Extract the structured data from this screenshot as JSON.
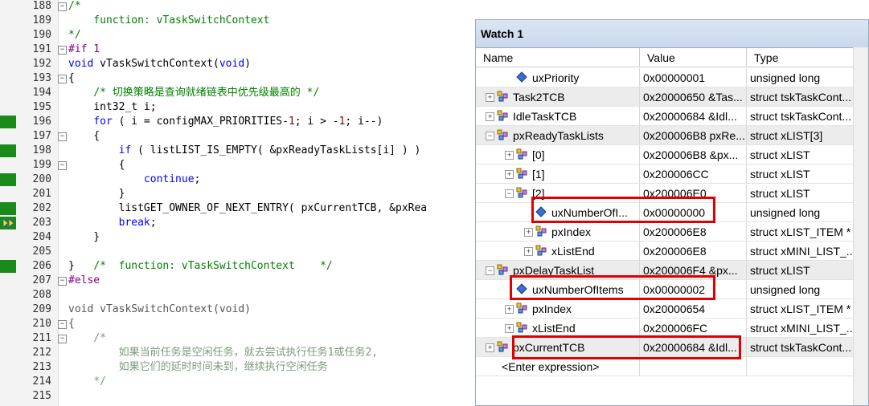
{
  "editor": {
    "lines": [
      {
        "n": "188",
        "fold": "−",
        "html": "<span class='cm'>/*</span>"
      },
      {
        "n": "189",
        "html": "<span class='cm'>    function: vTaskSwitchContext</span>"
      },
      {
        "n": "190",
        "html": "<span class='cm'>*/</span>"
      },
      {
        "n": "191",
        "fold": "−",
        "html": "<span class='pp'>#if 1</span>"
      },
      {
        "n": "192",
        "html": "<span class='kw'>void</span> vTaskSwitchContext(<span class='kw'>void</span>)"
      },
      {
        "n": "193",
        "fold": "−",
        "html": "{"
      },
      {
        "n": "194",
        "html": "    <span class='cm'>/* 切换策略是查询就绪链表中优先级最高的 */</span>"
      },
      {
        "n": "195",
        "html": "    int32_t i;"
      },
      {
        "n": "196",
        "bp": true,
        "html": "    <span class='kw'>for</span> ( i = configMAX_PRIORITIES-<span class='num'>1</span>; i &gt; -<span class='num'>1</span>; i--)"
      },
      {
        "n": "197",
        "fold": "−",
        "html": "    {"
      },
      {
        "n": "198",
        "bp": true,
        "html": "        <span class='kw'>if</span> ( listLIST_IS_EMPTY( &amp;pxReadyTaskLists[i] ) )"
      },
      {
        "n": "199",
        "fold": "−",
        "html": "        {"
      },
      {
        "n": "200",
        "bp": true,
        "html": "            <span class='kw'>continue</span>;"
      },
      {
        "n": "201",
        "html": "        }"
      },
      {
        "n": "202",
        "bp": true,
        "html": "        listGET_OWNER_OF_NEXT_ENTRY( pxCurrentTCB, &amp;pxRea"
      },
      {
        "n": "203",
        "bp": true,
        "arrow": true,
        "html": "        <span class='kw'>break</span>;"
      },
      {
        "n": "204",
        "html": "    }"
      },
      {
        "n": "205",
        "html": ""
      },
      {
        "n": "206",
        "bp": true,
        "html": "}   <span class='cm'>/*  function: vTaskSwitchContext    */</span>"
      },
      {
        "n": "207",
        "fold": "−",
        "html": "<span class='pp'>#else</span>"
      },
      {
        "n": "208",
        "html": ""
      },
      {
        "n": "209",
        "html": "<span class='gray'>void vTaskSwitchContext(void)</span>"
      },
      {
        "n": "210",
        "fold": "−",
        "html": "<span class='gray'>{</span>"
      },
      {
        "n": "211",
        "fold": "−",
        "html": "    <span class='cmg'>/*</span>"
      },
      {
        "n": "212",
        "html": "        <span class='cmg'>如果当前任务是空闲任务，就去尝试执行任务1或任务2,</span>"
      },
      {
        "n": "213",
        "html": "        <span class='cmg'>如果它们的延时时间未到，继续执行空闲任务</span>"
      },
      {
        "n": "214",
        "html": "    <span class='cmg'>*/</span>"
      },
      {
        "n": "215",
        "html": ""
      }
    ]
  },
  "watch": {
    "title": "Watch 1",
    "columns": {
      "name": "Name",
      "value": "Value",
      "type": "Type"
    },
    "rows": [
      {
        "depth": 1,
        "expander": "",
        "icon": "field-icon",
        "name": "uxPriority",
        "value": "0x00000001",
        "type": "unsigned long",
        "shade": false
      },
      {
        "depth": 0,
        "expander": "+",
        "icon": "struct-icon",
        "name": "Task2TCB",
        "value": "0x20000650 &Tas...",
        "type": "struct tskTaskCont...",
        "shade": true
      },
      {
        "depth": 0,
        "expander": "+",
        "icon": "struct-icon",
        "name": "IdleTaskTCB",
        "value": "0x20000684 &Idl...",
        "type": "struct tskTaskCont...",
        "shade": false
      },
      {
        "depth": 0,
        "expander": "−",
        "icon": "struct-icon",
        "name": "pxReadyTaskLists",
        "value": "0x200006B8 pxRe...",
        "type": "struct xLIST[3]",
        "shade": true
      },
      {
        "depth": 1,
        "expander": "+",
        "icon": "struct-icon",
        "name": "[0]",
        "value": "0x200006B8 &px...",
        "type": "struct xLIST",
        "shade": false
      },
      {
        "depth": 1,
        "expander": "+",
        "icon": "struct-icon",
        "name": "[1]",
        "value": "0x200006CC",
        "type": "struct xLIST",
        "shade": false
      },
      {
        "depth": 1,
        "expander": "−",
        "icon": "struct-icon",
        "name": "[2]",
        "value": "0x200006E0",
        "type": "struct xLIST",
        "shade": false
      },
      {
        "depth": 2,
        "expander": "",
        "icon": "field-icon",
        "name": "uxNumberOfI...",
        "value": "0x00000000",
        "type": "unsigned long",
        "shade": false
      },
      {
        "depth": 2,
        "expander": "+",
        "icon": "struct-icon",
        "name": "pxIndex",
        "value": "0x200006E8",
        "type": "struct xLIST_ITEM *",
        "shade": false
      },
      {
        "depth": 2,
        "expander": "+",
        "icon": "struct-icon",
        "name": "xListEnd",
        "value": "0x200006E8",
        "type": "struct xMINI_LIST_...",
        "shade": false
      },
      {
        "depth": 0,
        "expander": "−",
        "icon": "struct-icon",
        "name": "pxDelayTaskList",
        "value": "0x200006F4 &px...",
        "type": "struct xLIST",
        "shade": true
      },
      {
        "depth": 1,
        "expander": "",
        "icon": "field-icon",
        "name": "uxNumberOfItems",
        "value": "0x00000002",
        "type": "unsigned long",
        "shade": false
      },
      {
        "depth": 1,
        "expander": "+",
        "icon": "struct-icon",
        "name": "pxIndex",
        "value": "0x20000654",
        "type": "struct xLIST_ITEM *",
        "shade": false
      },
      {
        "depth": 1,
        "expander": "+",
        "icon": "struct-icon",
        "name": "xListEnd",
        "value": "0x200006FC",
        "type": "struct xMINI_LIST_...",
        "shade": false
      },
      {
        "depth": 0,
        "expander": "+",
        "icon": "struct-icon",
        "name": "pxCurrentTCB",
        "value": "0x20000684 &Idl...",
        "type": "struct tskTaskCont...",
        "shade": true
      }
    ],
    "enter_expression": "<Enter expression>"
  }
}
